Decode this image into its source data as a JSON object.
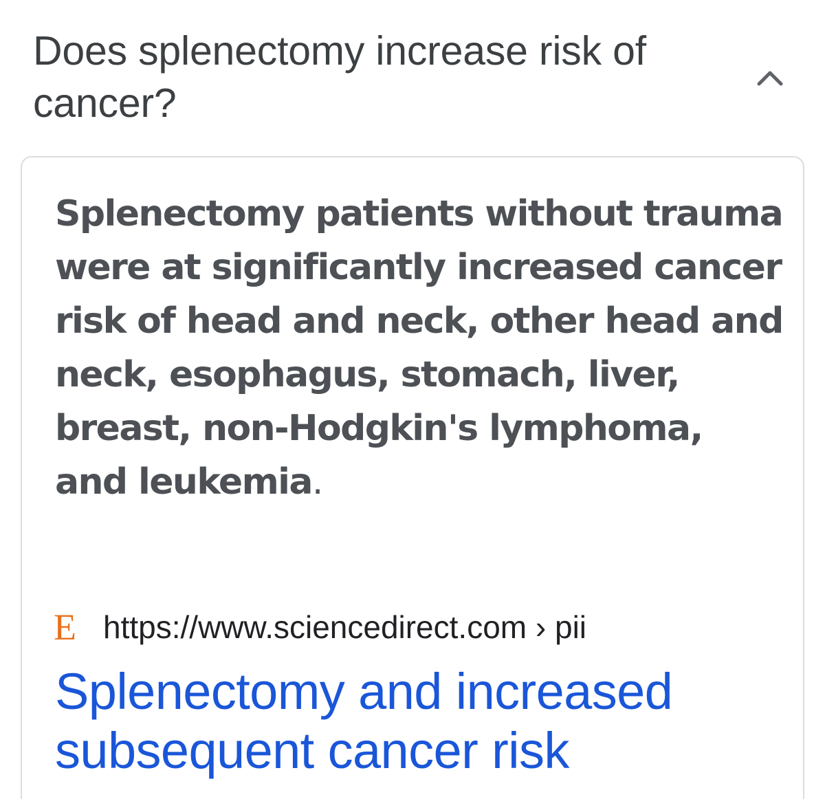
{
  "faq": {
    "question": "Does splenectomy increase risk of cancer?",
    "expanded_icon": "chevron-up-icon"
  },
  "answer": {
    "text": "Splenectomy patients without trauma were at significantly increased cancer risk of head and neck, other head and neck, esophagus, stomach, liver, breast, non-Hodgkin's lymphoma, and leukemia",
    "trailing": "."
  },
  "source": {
    "favicon_letter": "E",
    "url": "https://www.sciencedirect.com › pii"
  },
  "result": {
    "title": "Splenectomy and increased subsequent cancer risk"
  },
  "colors": {
    "question_text": "#3c4043",
    "answer_text": "#4d5156",
    "link": "#1a56d8",
    "favicon": "#e9711c",
    "card_border": "#dadce0"
  }
}
